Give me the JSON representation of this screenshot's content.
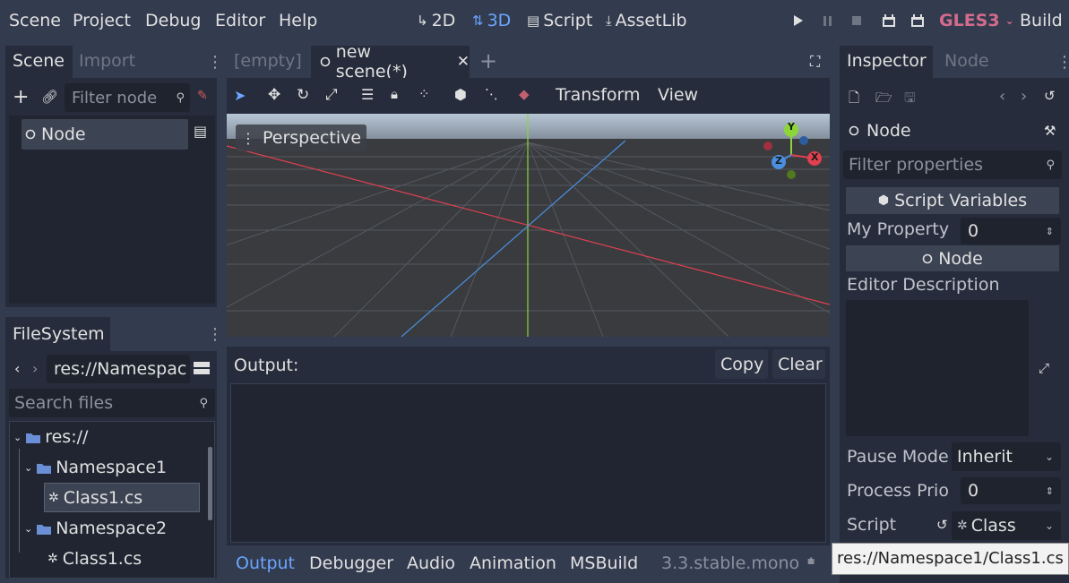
{
  "menu": {
    "scene": "Scene",
    "project": "Project",
    "debug": "Debug",
    "editor": "Editor",
    "help": "Help"
  },
  "workspaces": {
    "two_d": "2D",
    "three_d": "3D",
    "script": "Script",
    "assetlib": "AssetLib"
  },
  "renderer": "GLES3",
  "build": "Build",
  "scene_dock": {
    "tabs": [
      "Scene",
      "Import"
    ],
    "filter_placeholder": "Filter node",
    "root_node": "Node"
  },
  "filesystem": {
    "tab": "FileSystem",
    "path": "res://Namespac",
    "search_placeholder": "Search files",
    "tree": [
      {
        "label": "res://",
        "type": "folder"
      },
      {
        "label": "Namespace1",
        "type": "folder"
      },
      {
        "label": "Class1.cs",
        "type": "file"
      },
      {
        "label": "Namespace2",
        "type": "folder"
      },
      {
        "label": "Class1.cs",
        "type": "file"
      }
    ]
  },
  "scene_tabs": {
    "empty": "[empty]",
    "current": "new scene(*)"
  },
  "viewport_toolbar": {
    "transform": "Transform",
    "view": "View"
  },
  "viewport": {
    "perspective_label": "Perspective",
    "gizmo": {
      "y": "Y",
      "x": "X",
      "z": "Z"
    }
  },
  "output": {
    "title": "Output:",
    "copy": "Copy",
    "clear": "Clear"
  },
  "bottom_tabs": {
    "output": "Output",
    "debugger": "Debugger",
    "audio": "Audio",
    "animation": "Animation",
    "msbuild": "MSBuild",
    "version": "3.3.stable.mono"
  },
  "inspector": {
    "tabs": [
      "Inspector",
      "Node"
    ],
    "object": "Node",
    "filter_placeholder": "Filter properties",
    "script_variables": "Script Variables",
    "my_property_label": "My Property",
    "my_property_value": "0",
    "node_section": "Node",
    "editor_description": "Editor Description",
    "pause_mode_label": "Pause Mode",
    "pause_mode_value": "Inherit",
    "process_prio_label": "Process Prio",
    "process_prio_value": "0",
    "script_label": "Script",
    "script_value": "Class"
  },
  "tooltip": "res://Namespace1/Class1.cs",
  "colors": {
    "accent": "#6ba6ff",
    "gles3": "#d36b8c",
    "x_axis": "#e04050",
    "y_axis": "#8cd63a",
    "z_axis": "#4a8fe0"
  }
}
